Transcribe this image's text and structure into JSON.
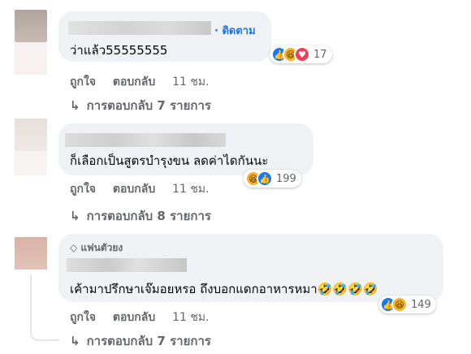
{
  "comments": [
    {
      "text": "ว่าแล้ว55555555",
      "follow_label": "· ติดตาม",
      "reaction_count": "17",
      "reaction_icons": [
        "like-icon",
        "haha-icon",
        "love-icon"
      ],
      "like_label": "ถูกใจ",
      "reply_label": "ตอบกลับ",
      "time": "11 ชม.",
      "replies_label": "การตอบกลับ 7 รายการ"
    },
    {
      "text": "ก็เลือกเป็นสูตรบำรุงขน ลดค่าไดกันนะ",
      "reaction_count": "199",
      "reaction_icons": [
        "haha-icon",
        "like-icon"
      ],
      "like_label": "ถูกใจ",
      "reply_label": "ตอบกลับ",
      "time": "11 ชม.",
      "replies_label": "การตอบกลับ 8 รายการ"
    },
    {
      "badge": "แฟนตัวยง",
      "text": "เค้ามาปรึกษาเจ๊มอยหรอ ถึงบอกแดกอาหารหมา🤣🤣🤣🤣",
      "reaction_count": "149",
      "reaction_icons": [
        "like-icon",
        "haha-icon"
      ],
      "like_label": "ถูกใจ",
      "reply_label": "ตอบกลับ",
      "time": "11 ชม.",
      "replies_label": "การตอบกลับ 7 รายการ"
    }
  ],
  "colors": {
    "bubble": "#f0f2f5",
    "link": "#1877f2",
    "secondary": "#65676b",
    "like": "#1877f2",
    "haha": "#f7b125",
    "love": "#f33e58"
  }
}
